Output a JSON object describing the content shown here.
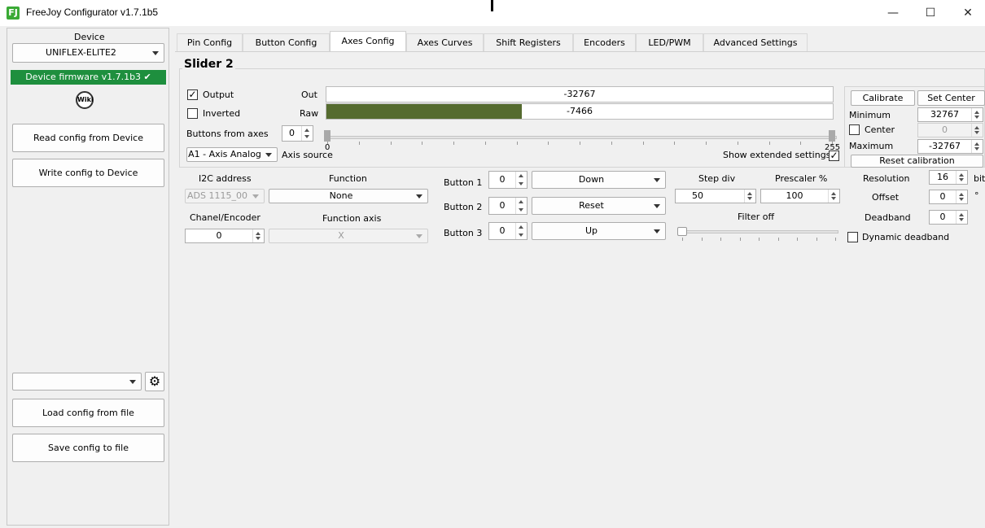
{
  "window": {
    "title": "FreeJoy Configurator v1.7.1b5",
    "icon_letter": "FJ",
    "minimize": "—",
    "maximize": "☐",
    "close": "✕"
  },
  "sidebar": {
    "device_label": "Device",
    "device_selected": "UNIFLEX-ELITE2",
    "firmware_text": "Device firmware v1.7.1b3 ✔",
    "wiki_label": "Wiki",
    "read_button": "Read config from Device",
    "write_button": "Write config to Device",
    "config_combo_value": "",
    "load_button": "Load config from file",
    "save_button": "Save config to file"
  },
  "tabs": [
    {
      "label": "Pin Config"
    },
    {
      "label": "Button Config"
    },
    {
      "label": "Axes Config",
      "active": true
    },
    {
      "label": "Axes Curves"
    },
    {
      "label": "Shift Registers"
    },
    {
      "label": "Encoders"
    },
    {
      "label": "LED/PWM"
    },
    {
      "label": "Advanced Settings"
    }
  ],
  "axis": {
    "title": "Slider 2",
    "output_label": "Output",
    "output_checked": true,
    "inverted_label": "Inverted",
    "inverted_checked": false,
    "out_label": "Out",
    "out_value": "-32767",
    "raw_label": "Raw",
    "raw_value": "-7466",
    "raw_fill_fraction": 0.386,
    "raw_fill_color": "#556b2f",
    "buttons_from_axes_label": "Buttons from axes",
    "buttons_from_axes_value": "0",
    "slider_min": "0",
    "slider_max": "255",
    "axis_source_value": "A1 - Axis Analog",
    "axis_source_label": "Axis source",
    "show_extended_label": "Show extended settings",
    "show_extended_checked": true,
    "calibrate_button": "Calibrate",
    "set_center_button": "Set Center",
    "minimum_label": "Minimum",
    "minimum_value": "32767",
    "center_label": "Center",
    "center_value": "0",
    "maximum_label": "Maximum",
    "maximum_value": "-32767",
    "reset_calibration_button": "Reset calibration"
  },
  "extended": {
    "i2c_label": "I2C address",
    "i2c_value": "ADS 1115_00",
    "function_label": "Function",
    "function_value": "None",
    "channel_label": "Chanel/Encoder",
    "channel_value": "0",
    "function_axis_label": "Function axis",
    "function_axis_value": "X",
    "buttons": [
      {
        "label": "Button 1",
        "num": "0",
        "action": "Down"
      },
      {
        "label": "Button 2",
        "num": "0",
        "action": "Reset"
      },
      {
        "label": "Button 3",
        "num": "0",
        "action": "Up"
      }
    ],
    "step_div_label": "Step div",
    "step_div_value": "50",
    "prescaler_label": "Prescaler %",
    "prescaler_value": "100",
    "filter_label": "Filter off",
    "resolution_label": "Resolution",
    "resolution_value": "16",
    "resolution_unit": "bit",
    "offset_label": "Offset",
    "offset_value": "0",
    "offset_unit": "°",
    "deadband_label": "Deadband",
    "deadband_value": "0",
    "dynamic_deadband_label": "Dynamic deadband",
    "dynamic_deadband_checked": false
  },
  "colors": {
    "firmware_bg": "#1e8f3e",
    "raw_fill": "#556b2f"
  }
}
